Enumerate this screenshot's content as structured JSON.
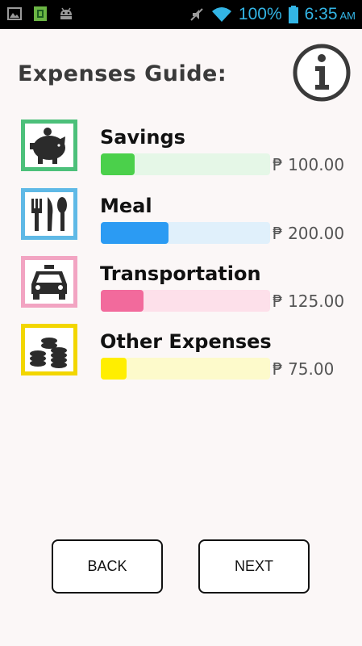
{
  "status_bar": {
    "battery_percent": "100%",
    "time": "6:35",
    "ampm": "AM",
    "icons": [
      "image-notification-icon",
      "sim-icon",
      "android-debug-icon",
      "mute-icon",
      "wifi-icon",
      "battery-icon"
    ]
  },
  "header": {
    "title": "Expenses Guide:",
    "info_icon": "info-icon"
  },
  "categories": [
    {
      "label": "Savings",
      "amount": "₱ 100.00",
      "icon": "piggy-bank-icon",
      "color": "#4cc07a",
      "bar_color": "#4bd04b",
      "track_color": "#e5f7e7",
      "fill": 0.2
    },
    {
      "label": "Meal",
      "amount": "₱ 200.00",
      "icon": "utensils-icon",
      "color": "#5fb9e6",
      "bar_color": "#2b9bf3",
      "track_color": "#e0f0fb",
      "fill": 0.4
    },
    {
      "label": "Transportation",
      "amount": "₱ 125.00",
      "icon": "taxi-icon",
      "color": "#f2a4c2",
      "bar_color": "#f26a9c",
      "track_color": "#fde0ea",
      "fill": 0.25
    },
    {
      "label": "Other Expenses",
      "amount": "₱ 75.00",
      "icon": "coins-icon",
      "color": "#f2d600",
      "bar_color": "#ffee00",
      "track_color": "#fdfacb",
      "fill": 0.15
    }
  ],
  "buttons": {
    "back": "BACK",
    "next": "NEXT"
  }
}
